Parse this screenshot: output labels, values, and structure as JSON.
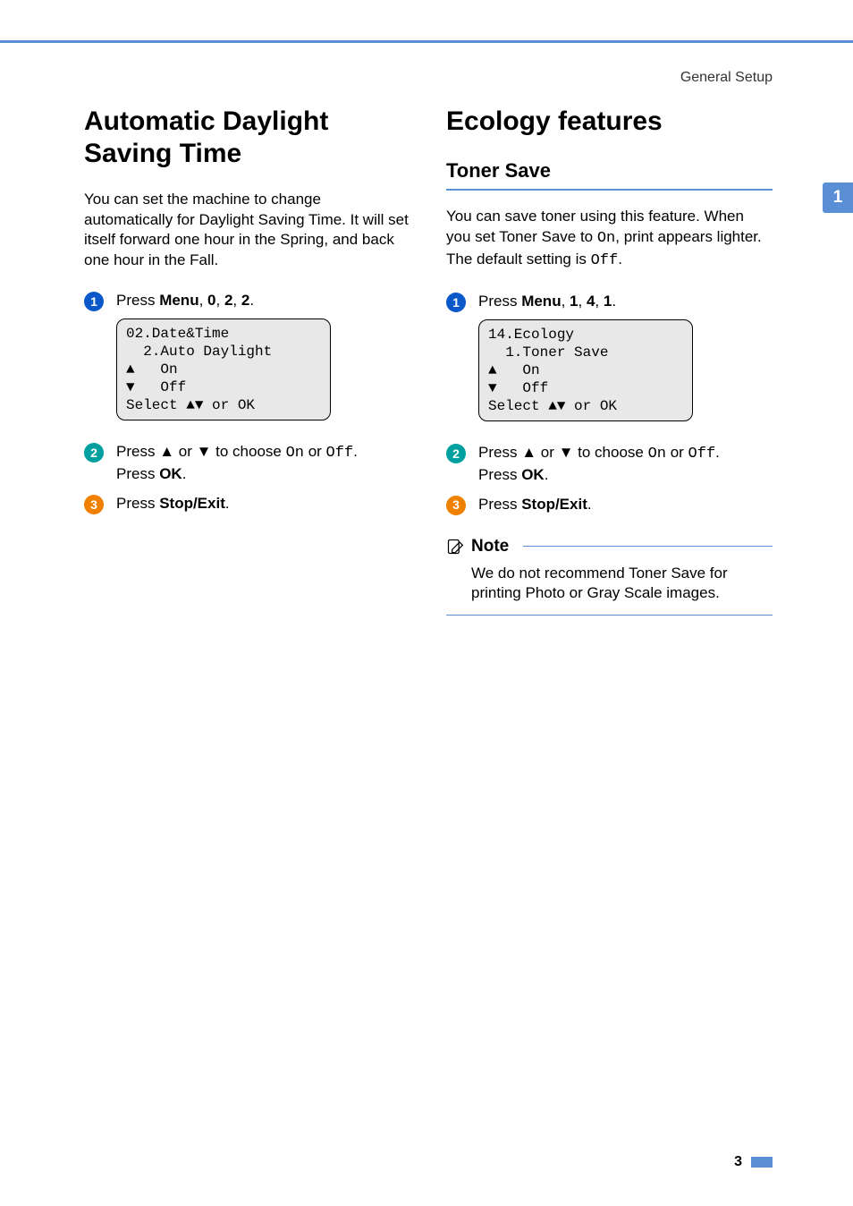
{
  "header": {
    "section": "General Setup"
  },
  "sideTab": "1",
  "left": {
    "title": "Automatic Daylight Saving Time",
    "intro": "You can set the machine to change automatically for Daylight Saving Time. It will set itself forward one hour in the Spring, and back one hour in the Fall.",
    "steps": {
      "s1": {
        "t1": "Press ",
        "b1": "Menu",
        "t2": ", ",
        "b2": "0",
        "t3": ", ",
        "b3": "2",
        "t4": ", ",
        "b4": "2",
        "t5": "."
      },
      "lcd": "02.Date&Time\n  2.Auto Daylight\n▲   On\n▼   Off\nSelect ▲▼ or OK",
      "s2": {
        "t1": "Press ",
        "a1": "a",
        "t2": " or ",
        "a2": "b",
        "t3": " to choose ",
        "m1": "On",
        "t4": " or ",
        "m2": "Off",
        "t5": ".",
        "line2a": "Press ",
        "line2b": "OK",
        "line2c": "."
      },
      "s3": {
        "t1": "Press ",
        "b1": "Stop/Exit",
        "t2": "."
      }
    }
  },
  "right": {
    "title": "Ecology features",
    "subhead": "Toner Save",
    "intro": {
      "t1": "You can save toner using this feature. When you set Toner Save to ",
      "m1": "On",
      "t2": ", print appears lighter. The default setting is ",
      "m2": "Off",
      "t3": "."
    },
    "steps": {
      "s1": {
        "t1": "Press ",
        "b1": "Menu",
        "t2": ", ",
        "b2": "1",
        "t3": ", ",
        "b3": "4",
        "t4": ", ",
        "b4": "1",
        "t5": "."
      },
      "lcd": "14.Ecology\n  1.Toner Save\n▲   On\n▼   Off\nSelect ▲▼ or OK",
      "s2": {
        "t1": "Press ",
        "a1": "a",
        "t2": " or ",
        "a2": "b",
        "t3": " to choose ",
        "m1": "On",
        "t4": " or ",
        "m2": "Off",
        "t5": ".",
        "line2a": "Press ",
        "line2b": "OK",
        "line2c": "."
      },
      "s3": {
        "t1": "Press ",
        "b1": "Stop/Exit",
        "t2": "."
      }
    },
    "note": {
      "title": "Note",
      "body": "We do not recommend Toner Save for printing Photo or Gray Scale images."
    }
  },
  "pageNumber": "3"
}
